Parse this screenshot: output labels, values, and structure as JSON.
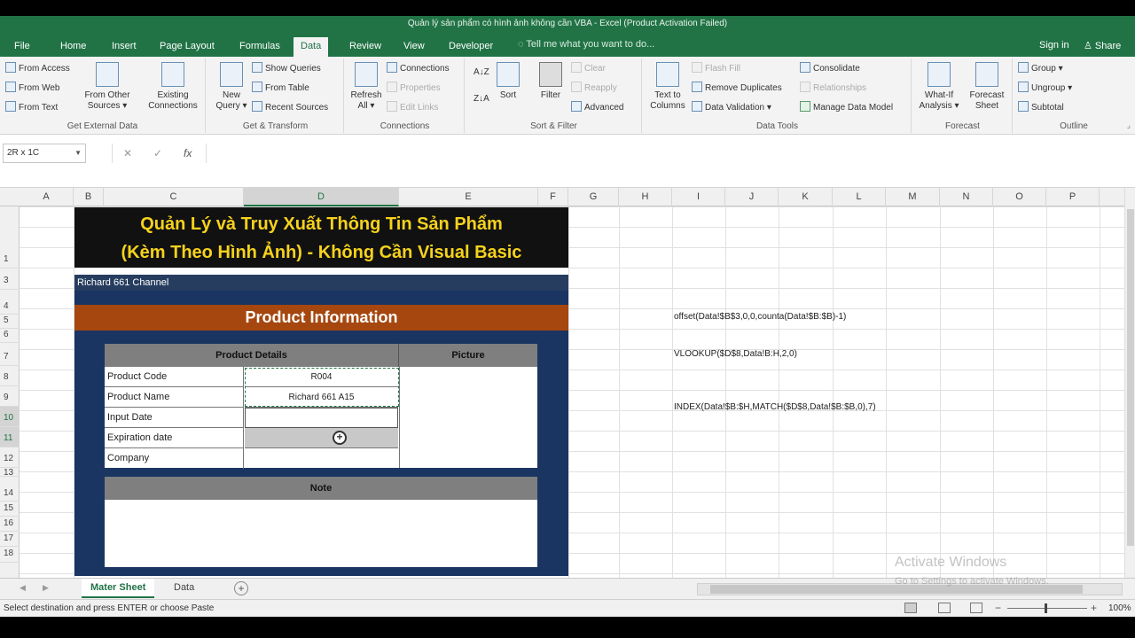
{
  "window": {
    "title": "Quản lý sản phẩm có hình ảnh không cần VBA - Excel (Product Activation Failed)"
  },
  "ribbon_tabs": [
    {
      "label": "File"
    },
    {
      "label": "Home"
    },
    {
      "label": "Insert"
    },
    {
      "label": "Page Layout"
    },
    {
      "label": "Formulas"
    },
    {
      "label": "Data"
    },
    {
      "label": "Review"
    },
    {
      "label": "View"
    },
    {
      "label": "Developer"
    }
  ],
  "active_tab": "Data",
  "tell_me": "Tell me what you want to do...",
  "sign_in": "Sign in",
  "share": "Share",
  "groups": {
    "get_external": {
      "label": "Get External Data",
      "from_access": "From Access",
      "from_web": "From Web",
      "from_text": "From Text",
      "from_other": "From Other Sources ▾",
      "existing": "Existing Connections"
    },
    "get_transform": {
      "label": "Get & Transform",
      "new_query": "New Query ▾",
      "show_queries": "Show Queries",
      "from_table": "From Table",
      "recent_sources": "Recent Sources"
    },
    "connections": {
      "label": "Connections",
      "refresh_all": "Refresh All ▾",
      "connections": "Connections",
      "properties": "Properties",
      "edit_links": "Edit Links"
    },
    "sort_filter": {
      "label": "Sort & Filter",
      "sort": "Sort",
      "filter": "Filter",
      "clear": "Clear",
      "reapply": "Reapply",
      "advanced": "Advanced"
    },
    "data_tools": {
      "label": "Data Tools",
      "text_to_columns": "Text to Columns",
      "flash_fill": "Flash Fill",
      "remove_duplicates": "Remove Duplicates",
      "data_validation": "Data Validation ▾",
      "consolidate": "Consolidate",
      "relationships": "Relationships",
      "manage_model": "Manage Data Model"
    },
    "forecast": {
      "label": "Forecast",
      "what_if": "What-If Analysis ▾",
      "forecast_sheet": "Forecast Sheet"
    },
    "outline": {
      "label": "Outline",
      "group": "Group ▾",
      "ungroup": "Ungroup ▾",
      "subtotal": "Subtotal"
    }
  },
  "name_box": "2R x 1C",
  "columns": [
    "A",
    "B",
    "C",
    "D",
    "E",
    "F",
    "G",
    "H",
    "I",
    "J",
    "K",
    "L",
    "M",
    "N",
    "O",
    "P"
  ],
  "rows": [
    "1",
    "",
    "3",
    "4",
    "5",
    "6",
    "7",
    "8",
    "9",
    "10",
    "11",
    "12",
    "13",
    "14",
    "15",
    "16",
    "17",
    "18"
  ],
  "sheet": {
    "banner_line1": "Quản Lý và Truy Xuất Thông Tin Sản Phẩm",
    "banner_line2": "(Kèm Theo Hình Ảnh) - Không Cần Visual Basic",
    "channel": "Richard 661 Channel",
    "product_information": "Product Information",
    "product_details_header": "Product Details",
    "picture_header": "Picture",
    "labels": [
      "Product Code",
      "Product Name",
      "Input Date",
      "Expiration date",
      "Company"
    ],
    "values": [
      "R004",
      "Richard 661 A15",
      "",
      "",
      ""
    ],
    "note_header": "Note"
  },
  "formulas": [
    "offset(Data!$B$3,0,0,counta(Data!$B:$B)-1)",
    "VLOOKUP($D$8,Data!B:H,2,0)",
    "INDEX(Data!$B:$H,MATCH($D$8,Data!$B:$B,0),7)"
  ],
  "sheet_tabs": [
    {
      "label": "Mater Sheet"
    },
    {
      "label": "Data"
    }
  ],
  "active_sheet": "Mater Sheet",
  "watermark": {
    "line1": "Activate Windows",
    "line2": "Go to Settings to activate Windows."
  },
  "status_text": "Select destination and press ENTER or choose Paste",
  "zoom": "100%"
}
